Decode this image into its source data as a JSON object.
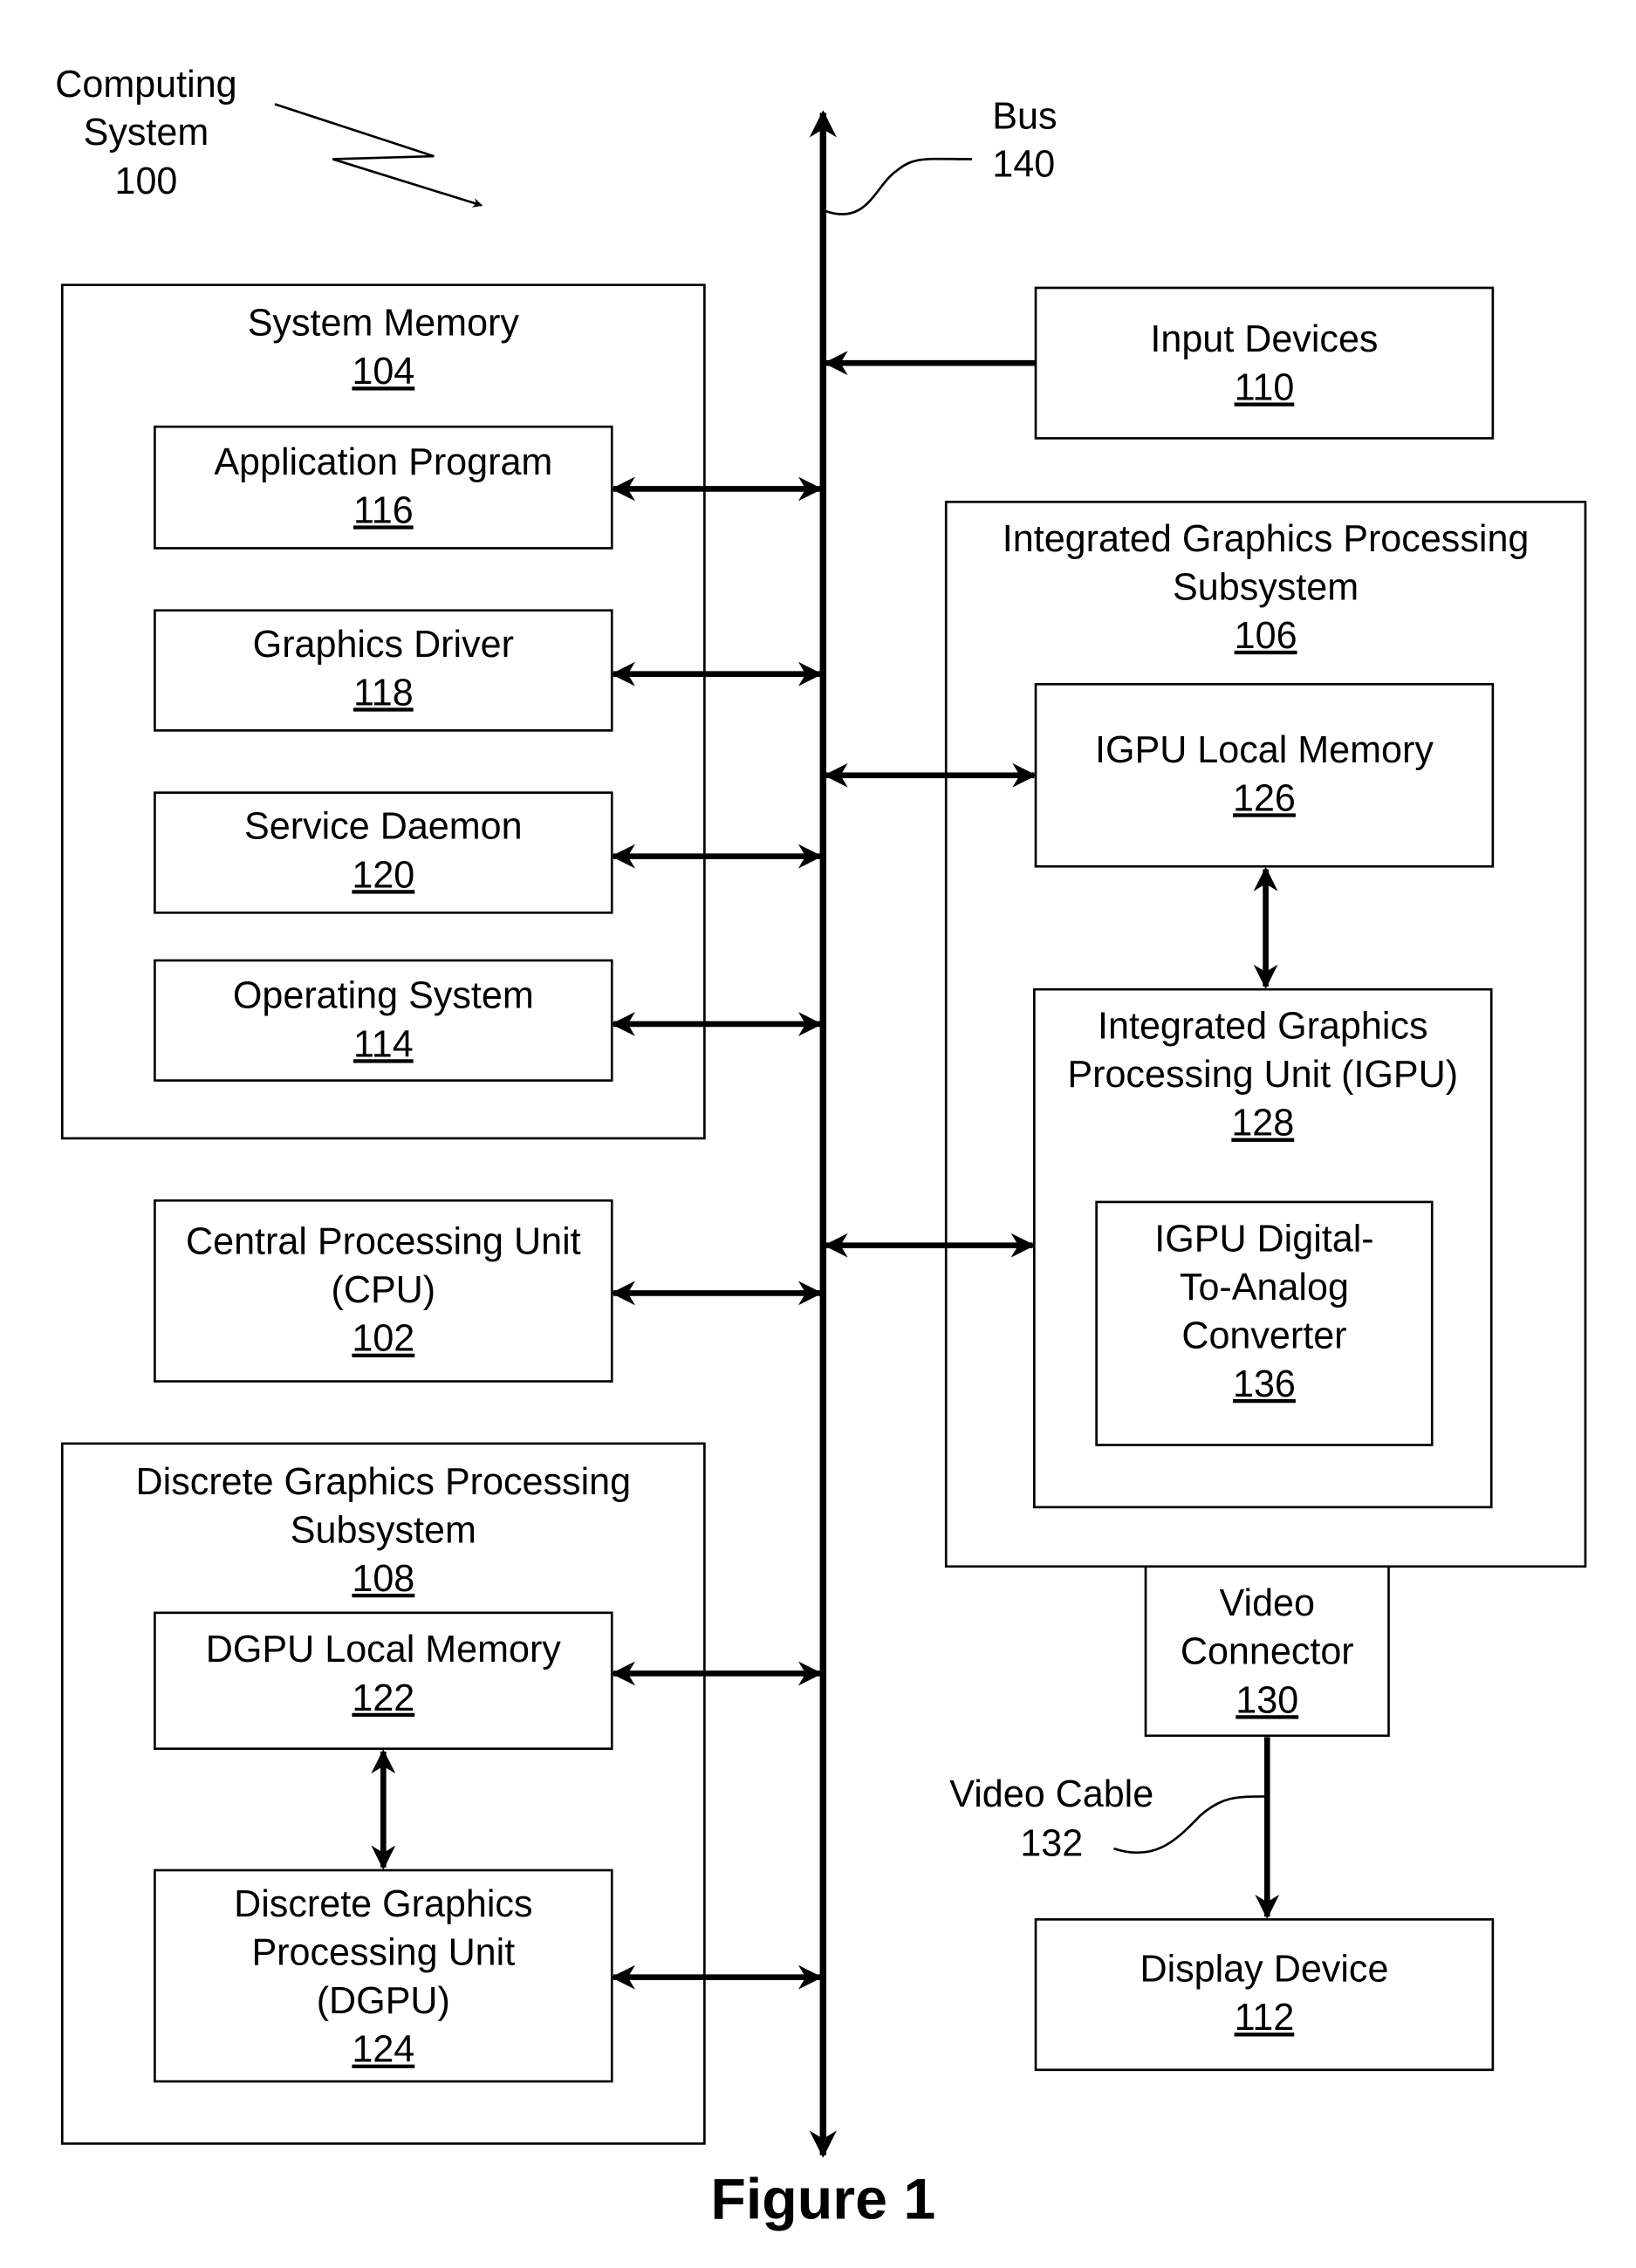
{
  "figure": {
    "caption": "Figure 1",
    "system_label": [
      "Computing",
      "System",
      "100"
    ],
    "bus_label": [
      "Bus",
      "140"
    ],
    "video_cable_label": [
      "Video Cable",
      "132"
    ]
  },
  "blocks": {
    "system_memory": {
      "lines": [
        "System Memory"
      ],
      "ref": "104"
    },
    "application_program": {
      "lines": [
        "Application Program"
      ],
      "ref": "116"
    },
    "graphics_driver": {
      "lines": [
        "Graphics Driver"
      ],
      "ref": "118"
    },
    "service_daemon": {
      "lines": [
        "Service Daemon"
      ],
      "ref": "120"
    },
    "operating_system": {
      "lines": [
        "Operating System"
      ],
      "ref": "114"
    },
    "cpu": {
      "lines": [
        "Central Processing Unit",
        "(CPU)"
      ],
      "ref": "102"
    },
    "dgps": {
      "lines": [
        "Discrete Graphics Processing",
        "Subsystem"
      ],
      "ref": "108"
    },
    "dgpu_local_memory": {
      "lines": [
        "DGPU Local Memory"
      ],
      "ref": "122"
    },
    "dgpu": {
      "lines": [
        "Discrete Graphics",
        "Processing Unit",
        "(DGPU)"
      ],
      "ref": "124"
    },
    "input_devices": {
      "lines": [
        "Input Devices"
      ],
      "ref": "110"
    },
    "igps": {
      "lines": [
        "Integrated Graphics Processing",
        "Subsystem"
      ],
      "ref": "106"
    },
    "igpu_local_memory": {
      "lines": [
        "IGPU Local Memory"
      ],
      "ref": "126"
    },
    "igpu": {
      "lines": [
        "Integrated Graphics",
        "Processing Unit (IGPU)"
      ],
      "ref": "128"
    },
    "igpu_dac": {
      "lines": [
        "IGPU Digital-",
        "To-Analog",
        "Converter"
      ],
      "ref": "136"
    },
    "video_connector": {
      "lines": [
        "Video",
        "Connector"
      ],
      "ref": "130"
    },
    "display_device": {
      "lines": [
        "Display Device"
      ],
      "ref": "112"
    }
  }
}
